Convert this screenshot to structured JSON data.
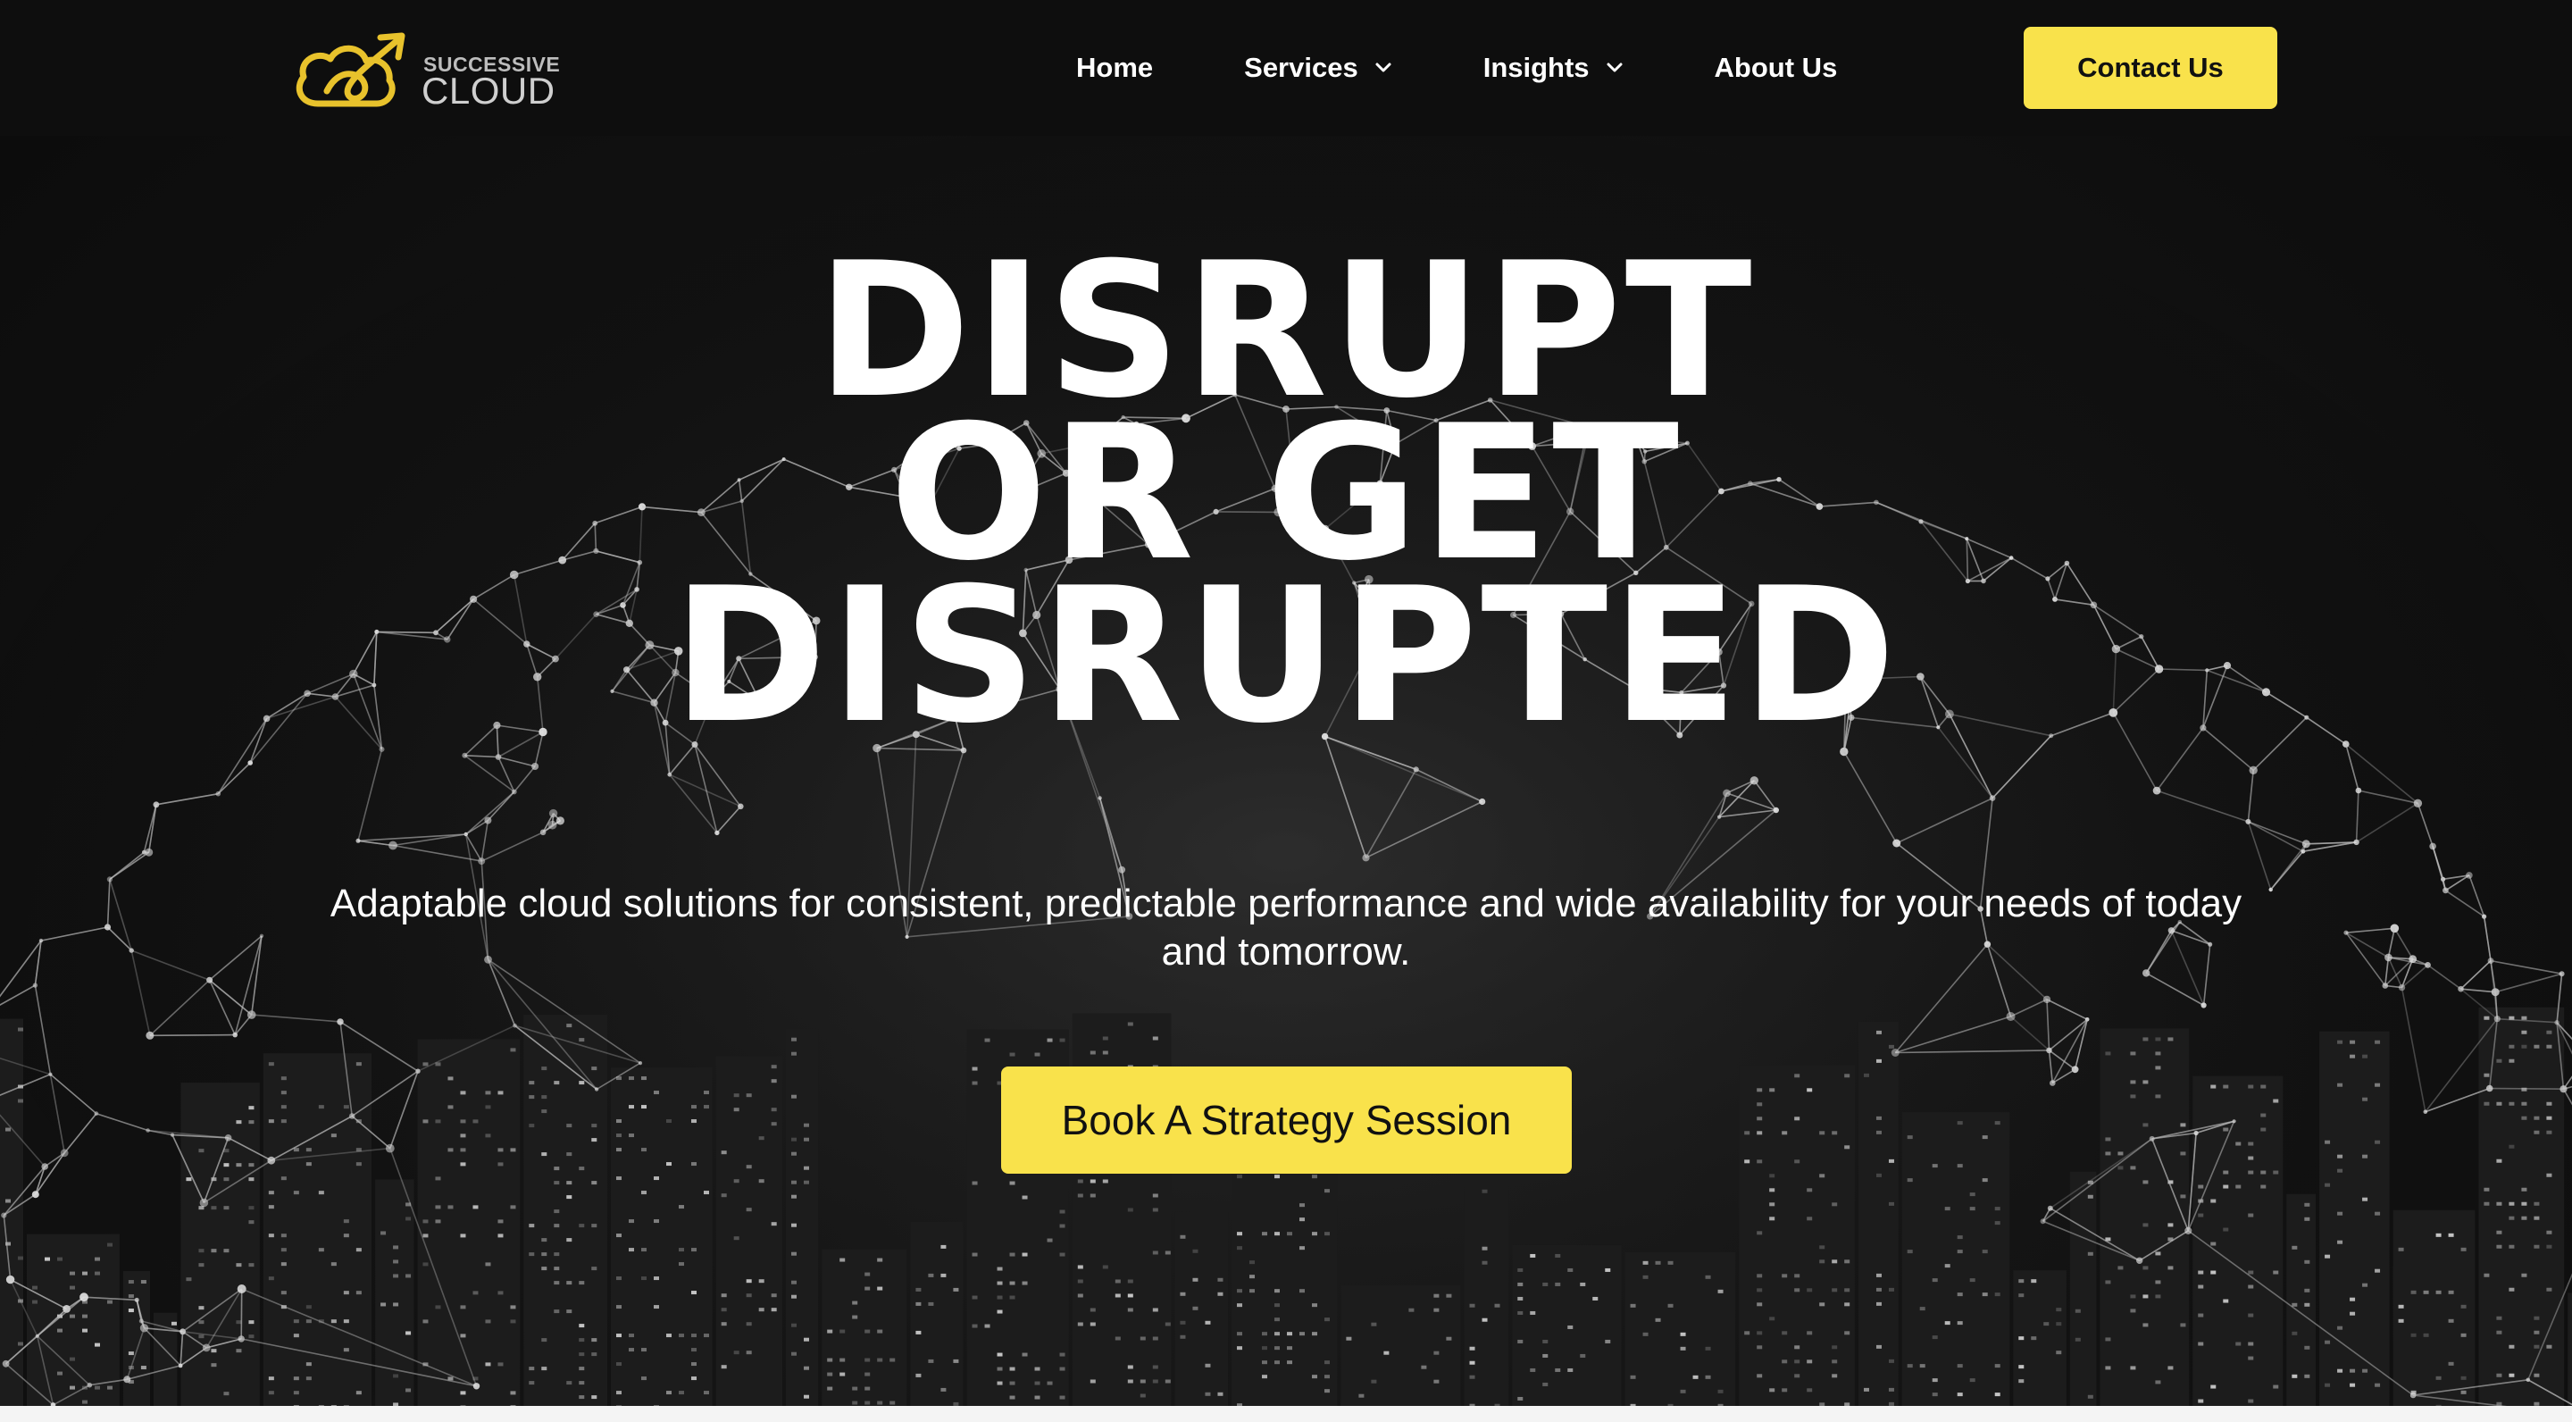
{
  "brand": {
    "logo_top": "SUCCESSIVE",
    "logo_bottom": "CLOUD",
    "logo_icon": "cloud-arrow-logo-icon",
    "accent_color": "#f9e24b"
  },
  "nav": {
    "items": [
      {
        "label": "Home",
        "has_dropdown": false
      },
      {
        "label": "Services",
        "has_dropdown": true
      },
      {
        "label": "Insights",
        "has_dropdown": true
      },
      {
        "label": "About Us",
        "has_dropdown": false
      }
    ],
    "dropdown_icon": "chevron-down-icon"
  },
  "header": {
    "contact_label": "Contact Us"
  },
  "hero": {
    "title_lines": [
      "DISRUPT",
      "OR GET",
      "DISRUPTED"
    ],
    "subtitle": "Adaptable cloud solutions for consistent, predictable performance and wide availability for your needs of today and tomorrow.",
    "cta_label": "Book A Strategy Session"
  },
  "colors": {
    "background": "#0d0d0d",
    "text": "#ffffff",
    "button_text": "#111111"
  }
}
